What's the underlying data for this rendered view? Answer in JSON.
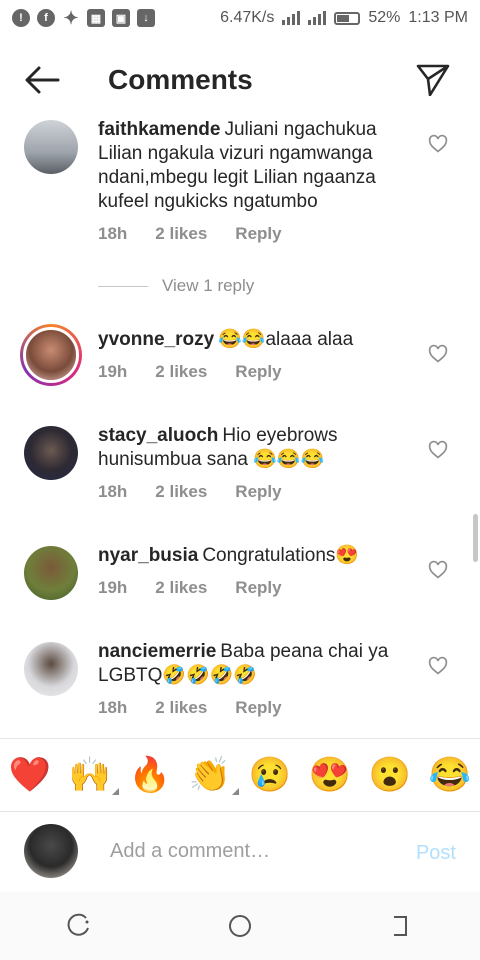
{
  "status_bar": {
    "speed": "6.47K/s",
    "battery": "52%",
    "time": "1:13 PM",
    "icons": [
      "warning-icon",
      "facebook-icon",
      "twitter-icon",
      "gallery-icon",
      "image-icon",
      "download-icon"
    ]
  },
  "header": {
    "title": "Comments",
    "back_icon": "arrow-left-icon",
    "send_icon": "paper-plane-icon"
  },
  "comments": [
    {
      "username": "faithkamende",
      "text": "Juliani ngachukua Lilian ngakula vizuri ngamwanga ndani,mbegu legit  Lilian ngaanza kufeel ngukicks ngatumbo",
      "time": "18h",
      "likes": "2 likes",
      "reply": "Reply",
      "avatar_color": "#b7bcc2"
    },
    {
      "username": "yvonne_rozy",
      "text": "😂😂alaaa alaa",
      "time": "19h",
      "likes": "2 likes",
      "reply": "Reply",
      "avatar_color": "#d9a89a"
    },
    {
      "username": "stacy_aluoch",
      "text": "Hio eyebrows hunisumbua sana 😂😂😂",
      "time": "18h",
      "likes": "2 likes",
      "reply": "Reply",
      "avatar_color": "#3d3a45"
    },
    {
      "username": "nyar_busia",
      "text": "Congratulations😍",
      "time": "19h",
      "likes": "2 likes",
      "reply": "Reply",
      "avatar_color": "#8a7a4a"
    },
    {
      "username": "nanciemerrie",
      "text": "Baba peana chai ya LGBTQ🤣🤣🤣🤣",
      "time": "18h",
      "likes": "2 likes",
      "reply": "Reply",
      "avatar_color": "#cfcfd4"
    }
  ],
  "view_reply": "View 1 reply",
  "emoji_bar": [
    "❤️",
    "🙌",
    "🔥",
    "👏",
    "😢",
    "😍",
    "😮",
    "😂"
  ],
  "input": {
    "placeholder": "Add a comment…",
    "post_label": "Post",
    "avatar_color": "#3a3a3a"
  }
}
